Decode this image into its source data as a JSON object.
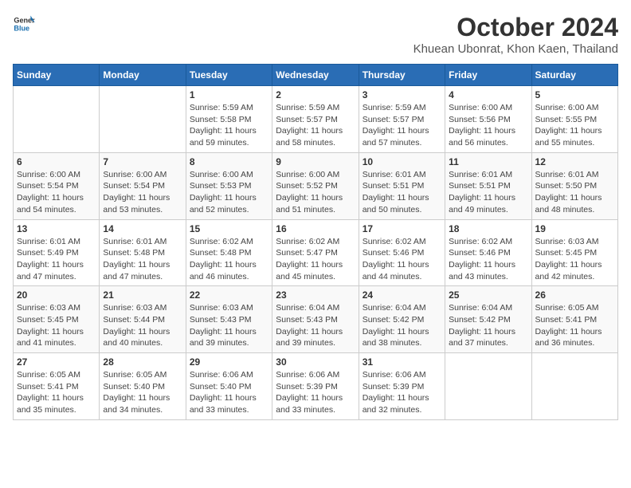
{
  "header": {
    "logo": {
      "general": "General",
      "blue": "Blue"
    },
    "title": "October 2024",
    "location": "Khuean Ubonrat, Khon Kaen, Thailand"
  },
  "calendar": {
    "days_of_week": [
      "Sunday",
      "Monday",
      "Tuesday",
      "Wednesday",
      "Thursday",
      "Friday",
      "Saturday"
    ],
    "weeks": [
      [
        {
          "day": "",
          "sunrise": "",
          "sunset": "",
          "daylight": ""
        },
        {
          "day": "",
          "sunrise": "",
          "sunset": "",
          "daylight": ""
        },
        {
          "day": "1",
          "sunrise": "Sunrise: 5:59 AM",
          "sunset": "Sunset: 5:58 PM",
          "daylight": "Daylight: 11 hours and 59 minutes."
        },
        {
          "day": "2",
          "sunrise": "Sunrise: 5:59 AM",
          "sunset": "Sunset: 5:57 PM",
          "daylight": "Daylight: 11 hours and 58 minutes."
        },
        {
          "day": "3",
          "sunrise": "Sunrise: 5:59 AM",
          "sunset": "Sunset: 5:57 PM",
          "daylight": "Daylight: 11 hours and 57 minutes."
        },
        {
          "day": "4",
          "sunrise": "Sunrise: 6:00 AM",
          "sunset": "Sunset: 5:56 PM",
          "daylight": "Daylight: 11 hours and 56 minutes."
        },
        {
          "day": "5",
          "sunrise": "Sunrise: 6:00 AM",
          "sunset": "Sunset: 5:55 PM",
          "daylight": "Daylight: 11 hours and 55 minutes."
        }
      ],
      [
        {
          "day": "6",
          "sunrise": "Sunrise: 6:00 AM",
          "sunset": "Sunset: 5:54 PM",
          "daylight": "Daylight: 11 hours and 54 minutes."
        },
        {
          "day": "7",
          "sunrise": "Sunrise: 6:00 AM",
          "sunset": "Sunset: 5:54 PM",
          "daylight": "Daylight: 11 hours and 53 minutes."
        },
        {
          "day": "8",
          "sunrise": "Sunrise: 6:00 AM",
          "sunset": "Sunset: 5:53 PM",
          "daylight": "Daylight: 11 hours and 52 minutes."
        },
        {
          "day": "9",
          "sunrise": "Sunrise: 6:00 AM",
          "sunset": "Sunset: 5:52 PM",
          "daylight": "Daylight: 11 hours and 51 minutes."
        },
        {
          "day": "10",
          "sunrise": "Sunrise: 6:01 AM",
          "sunset": "Sunset: 5:51 PM",
          "daylight": "Daylight: 11 hours and 50 minutes."
        },
        {
          "day": "11",
          "sunrise": "Sunrise: 6:01 AM",
          "sunset": "Sunset: 5:51 PM",
          "daylight": "Daylight: 11 hours and 49 minutes."
        },
        {
          "day": "12",
          "sunrise": "Sunrise: 6:01 AM",
          "sunset": "Sunset: 5:50 PM",
          "daylight": "Daylight: 11 hours and 48 minutes."
        }
      ],
      [
        {
          "day": "13",
          "sunrise": "Sunrise: 6:01 AM",
          "sunset": "Sunset: 5:49 PM",
          "daylight": "Daylight: 11 hours and 47 minutes."
        },
        {
          "day": "14",
          "sunrise": "Sunrise: 6:01 AM",
          "sunset": "Sunset: 5:48 PM",
          "daylight": "Daylight: 11 hours and 47 minutes."
        },
        {
          "day": "15",
          "sunrise": "Sunrise: 6:02 AM",
          "sunset": "Sunset: 5:48 PM",
          "daylight": "Daylight: 11 hours and 46 minutes."
        },
        {
          "day": "16",
          "sunrise": "Sunrise: 6:02 AM",
          "sunset": "Sunset: 5:47 PM",
          "daylight": "Daylight: 11 hours and 45 minutes."
        },
        {
          "day": "17",
          "sunrise": "Sunrise: 6:02 AM",
          "sunset": "Sunset: 5:46 PM",
          "daylight": "Daylight: 11 hours and 44 minutes."
        },
        {
          "day": "18",
          "sunrise": "Sunrise: 6:02 AM",
          "sunset": "Sunset: 5:46 PM",
          "daylight": "Daylight: 11 hours and 43 minutes."
        },
        {
          "day": "19",
          "sunrise": "Sunrise: 6:03 AM",
          "sunset": "Sunset: 5:45 PM",
          "daylight": "Daylight: 11 hours and 42 minutes."
        }
      ],
      [
        {
          "day": "20",
          "sunrise": "Sunrise: 6:03 AM",
          "sunset": "Sunset: 5:45 PM",
          "daylight": "Daylight: 11 hours and 41 minutes."
        },
        {
          "day": "21",
          "sunrise": "Sunrise: 6:03 AM",
          "sunset": "Sunset: 5:44 PM",
          "daylight": "Daylight: 11 hours and 40 minutes."
        },
        {
          "day": "22",
          "sunrise": "Sunrise: 6:03 AM",
          "sunset": "Sunset: 5:43 PM",
          "daylight": "Daylight: 11 hours and 39 minutes."
        },
        {
          "day": "23",
          "sunrise": "Sunrise: 6:04 AM",
          "sunset": "Sunset: 5:43 PM",
          "daylight": "Daylight: 11 hours and 39 minutes."
        },
        {
          "day": "24",
          "sunrise": "Sunrise: 6:04 AM",
          "sunset": "Sunset: 5:42 PM",
          "daylight": "Daylight: 11 hours and 38 minutes."
        },
        {
          "day": "25",
          "sunrise": "Sunrise: 6:04 AM",
          "sunset": "Sunset: 5:42 PM",
          "daylight": "Daylight: 11 hours and 37 minutes."
        },
        {
          "day": "26",
          "sunrise": "Sunrise: 6:05 AM",
          "sunset": "Sunset: 5:41 PM",
          "daylight": "Daylight: 11 hours and 36 minutes."
        }
      ],
      [
        {
          "day": "27",
          "sunrise": "Sunrise: 6:05 AM",
          "sunset": "Sunset: 5:41 PM",
          "daylight": "Daylight: 11 hours and 35 minutes."
        },
        {
          "day": "28",
          "sunrise": "Sunrise: 6:05 AM",
          "sunset": "Sunset: 5:40 PM",
          "daylight": "Daylight: 11 hours and 34 minutes."
        },
        {
          "day": "29",
          "sunrise": "Sunrise: 6:06 AM",
          "sunset": "Sunset: 5:40 PM",
          "daylight": "Daylight: 11 hours and 33 minutes."
        },
        {
          "day": "30",
          "sunrise": "Sunrise: 6:06 AM",
          "sunset": "Sunset: 5:39 PM",
          "daylight": "Daylight: 11 hours and 33 minutes."
        },
        {
          "day": "31",
          "sunrise": "Sunrise: 6:06 AM",
          "sunset": "Sunset: 5:39 PM",
          "daylight": "Daylight: 11 hours and 32 minutes."
        },
        {
          "day": "",
          "sunrise": "",
          "sunset": "",
          "daylight": ""
        },
        {
          "day": "",
          "sunrise": "",
          "sunset": "",
          "daylight": ""
        }
      ]
    ]
  }
}
